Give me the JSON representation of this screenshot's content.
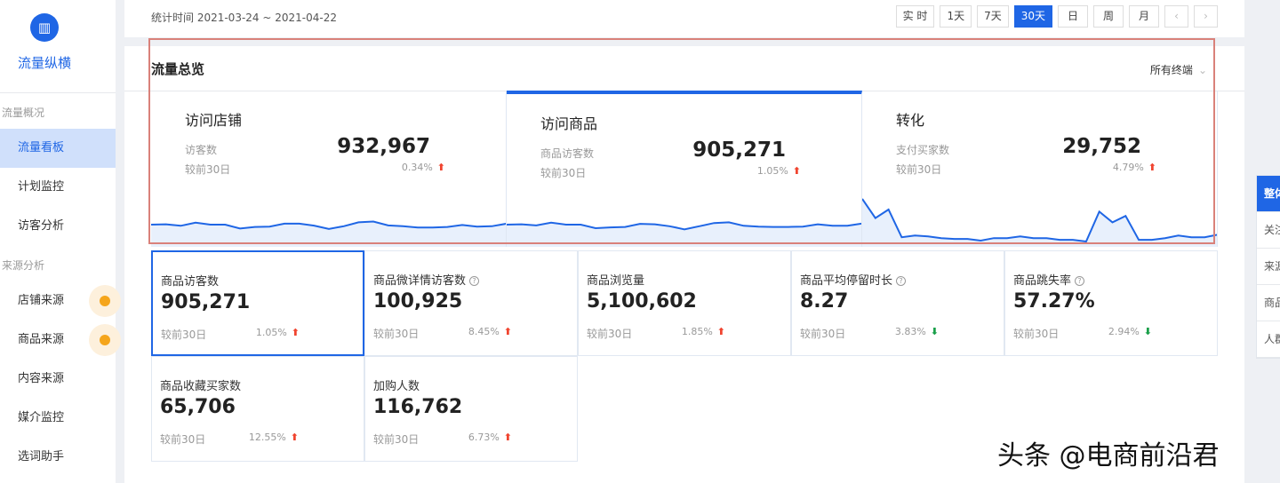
{
  "sidebar": {
    "logo_icon": "bar-chart-icon",
    "brand": "流量纵横",
    "groups": [
      "流量概况",
      "来源分析"
    ],
    "items": [
      "流量看板",
      "计划监控",
      "访客分析",
      "店铺来源",
      "商品来源",
      "内容来源",
      "媒介监控",
      "选词助手"
    ]
  },
  "topbar": {
    "stat_time": "统计时间 2021-03-24 ~ 2021-04-22",
    "buttons": [
      "实 时",
      "1天",
      "7天",
      "30天",
      "日",
      "周",
      "月"
    ],
    "prev": "‹",
    "next": "›",
    "active": "30天"
  },
  "main": {
    "title": "流量总览",
    "terminal": "所有终端",
    "terminal_icon": "chevron-down-icon",
    "overview": [
      {
        "title": "访问店铺",
        "label": "访客数",
        "value": "932,967",
        "compare": "较前30日",
        "pct": "0.34%",
        "dir": "up",
        "spark": [
          50,
          52,
          44,
          60,
          50,
          50,
          30,
          38,
          40,
          55,
          55,
          45,
          28,
          42,
          62,
          66,
          46,
          42,
          35,
          35,
          38,
          48,
          40,
          42,
          55
        ]
      },
      {
        "title": "访问商品",
        "label": "商品访客数",
        "value": "905,271",
        "compare": "较前30日",
        "pct": "1.05%",
        "dir": "up",
        "spark": [
          50,
          52,
          46,
          60,
          50,
          50,
          32,
          36,
          38,
          54,
          52,
          42,
          26,
          42,
          58,
          62,
          44,
          40,
          38,
          38,
          40,
          52,
          44,
          44,
          56
        ]
      },
      {
        "title": "转化",
        "label": "支付买家数",
        "value": "29,752",
        "compare": "较前30日",
        "pct": "4.79%",
        "dir": "up",
        "spark": [
          100,
          55,
          75,
          10,
          14,
          12,
          8,
          6,
          6,
          2,
          8,
          8,
          12,
          8,
          8,
          4,
          4,
          0,
          70,
          45,
          60,
          4,
          4,
          8,
          14,
          10,
          10,
          16
        ]
      }
    ],
    "metrics": [
      {
        "name": "商品访客数",
        "help": false,
        "value": "905,271",
        "compare": "较前30日",
        "pct": "1.05%",
        "dir": "up"
      },
      {
        "name": "商品微详情访客数",
        "help": true,
        "value": "100,925",
        "compare": "较前30日",
        "pct": "8.45%",
        "dir": "up"
      },
      {
        "name": "商品浏览量",
        "help": false,
        "value": "5,100,602",
        "compare": "较前30日",
        "pct": "1.85%",
        "dir": "up"
      },
      {
        "name": "商品平均停留时长",
        "help": true,
        "value": "8.27",
        "compare": "较前30日",
        "pct": "3.83%",
        "dir": "down"
      },
      {
        "name": "商品跳失率",
        "help": true,
        "value": "57.27%",
        "compare": "较前30日",
        "pct": "2.94%",
        "dir": "down"
      },
      {
        "name": "商品收藏买家数",
        "help": false,
        "value": "65,706",
        "compare": "较前30日",
        "pct": "12.55%",
        "dir": "up"
      },
      {
        "name": "加购人数",
        "help": false,
        "value": "116,762",
        "compare": "较前30日",
        "pct": "6.73%",
        "dir": "up"
      }
    ]
  },
  "right_tabs": [
    "整体",
    "关注",
    "来源",
    "商品",
    "人群"
  ],
  "watermark": "头条 @电商前沿君",
  "colors": {
    "accent": "#1f66e5",
    "up": "#f0442f",
    "down": "#1aa04a",
    "highlight": "#d9817a"
  }
}
